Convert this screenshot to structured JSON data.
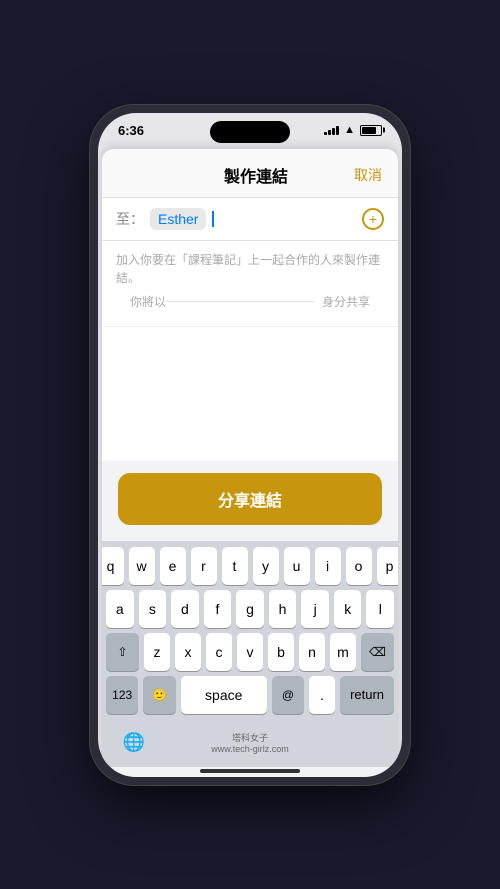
{
  "status": {
    "time": "6:36",
    "signal_bars": [
      3,
      5,
      7,
      9,
      11
    ],
    "battery_level": 80
  },
  "sheet": {
    "title": "製作連結",
    "cancel_label": "取消"
  },
  "to_field": {
    "label": "至：",
    "recipient": "Esther"
  },
  "description": {
    "text": "加入你要在「課程筆記」上一起合作的人來製作連結。",
    "identity_label": "身分共享",
    "identity_prefix": "你將以"
  },
  "share_button": {
    "label": "分享連結"
  },
  "keyboard": {
    "row1": [
      "q",
      "w",
      "e",
      "r",
      "t",
      "y",
      "u",
      "i",
      "o",
      "p"
    ],
    "row2": [
      "a",
      "s",
      "d",
      "f",
      "g",
      "h",
      "j",
      "k",
      "l"
    ],
    "row3": [
      "z",
      "x",
      "c",
      "v",
      "b",
      "n",
      "m"
    ],
    "shift_label": "⇧",
    "delete_label": "⌫",
    "numbers_label": "123",
    "emoji_label": "🙂",
    "space_label": "space",
    "at_label": "@",
    "period_label": ".",
    "return_label": "return",
    "globe_label": "🌐"
  },
  "watermark": {
    "line1": "塔科女子",
    "line2": "www.tech-girlz.com"
  }
}
